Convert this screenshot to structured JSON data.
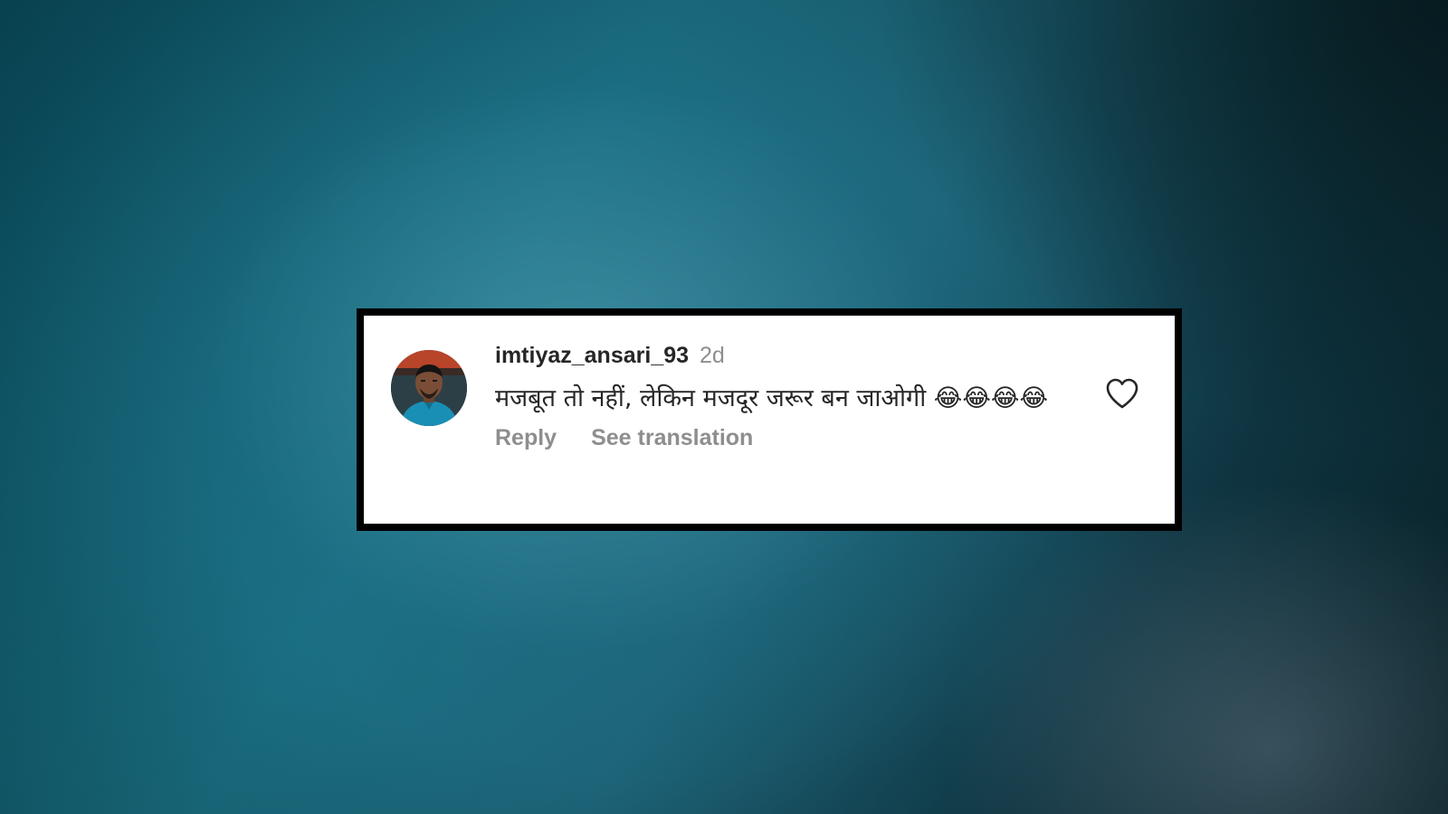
{
  "comment": {
    "username": "imtiyaz_ansari_93",
    "timestamp": "2d",
    "text": "मजबूत तो नहीं, लेकिन मजदूर जरूर बन जाओगी 😂😂😂😂",
    "actions": {
      "reply_label": "Reply",
      "translate_label": "See translation"
    },
    "avatar_icon": "user-avatar-photo",
    "like_icon": "heart-outline-icon"
  },
  "colors": {
    "username": "#262626",
    "secondary_text": "#8e8e8e",
    "card_border": "#000000",
    "card_background": "#ffffff"
  }
}
